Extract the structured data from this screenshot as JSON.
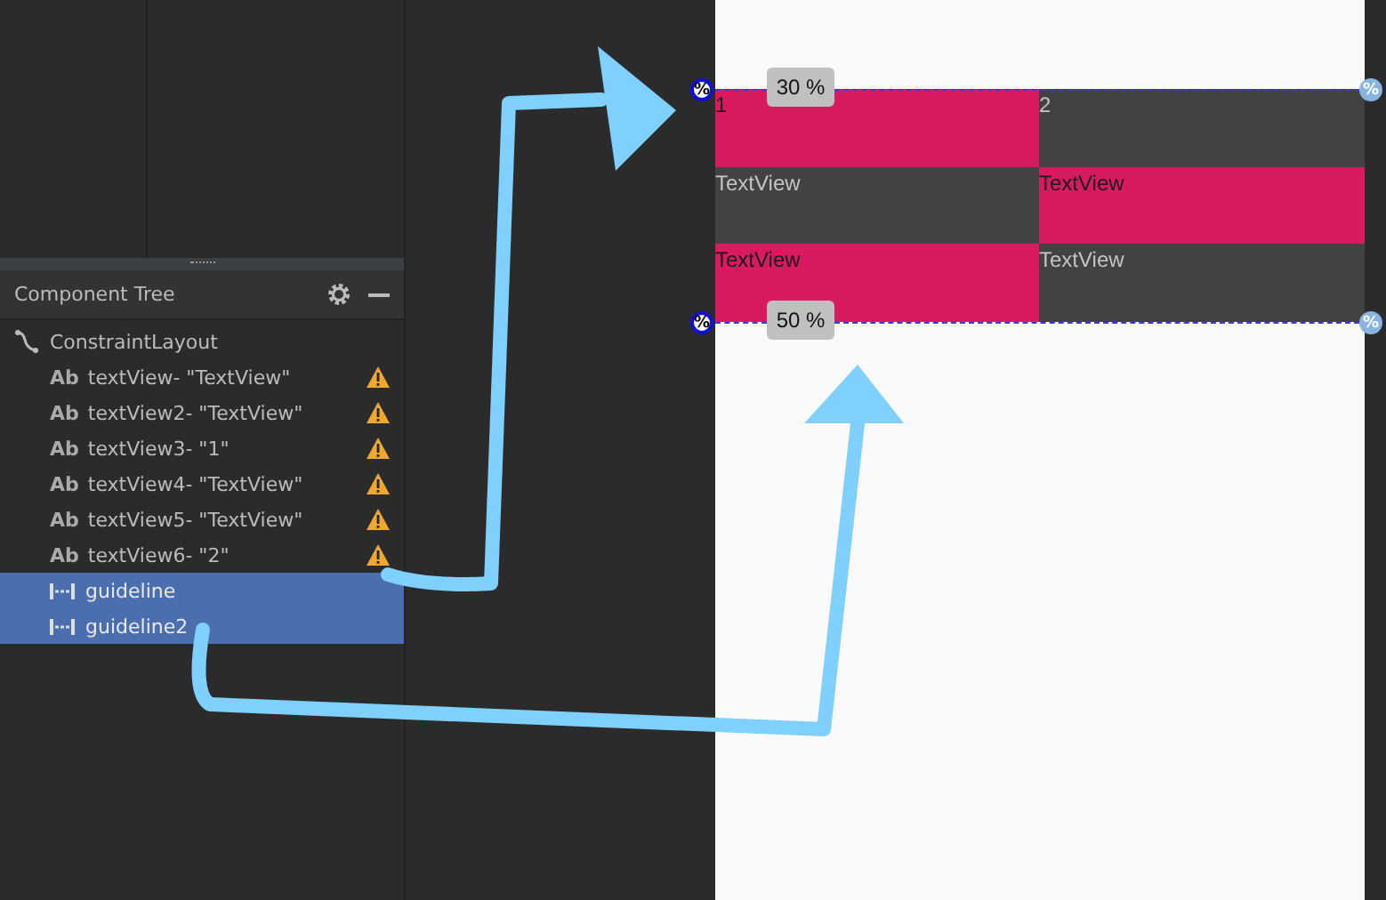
{
  "component_tree": {
    "title": "Component Tree",
    "items": [
      {
        "kind": "layout",
        "label": "ConstraintLayout",
        "warning": false,
        "selected": false
      },
      {
        "kind": "text",
        "icon_text": "Ab",
        "label": "textView- \"TextView\"",
        "warning": true,
        "selected": false
      },
      {
        "kind": "text",
        "icon_text": "Ab",
        "label": "textView2- \"TextView\"",
        "warning": true,
        "selected": false
      },
      {
        "kind": "text",
        "icon_text": "Ab",
        "label": "textView3- \"1\"",
        "warning": true,
        "selected": false
      },
      {
        "kind": "text",
        "icon_text": "Ab",
        "label": "textView4- \"TextView\"",
        "warning": true,
        "selected": false
      },
      {
        "kind": "text",
        "icon_text": "Ab",
        "label": "textView5- \"TextView\"",
        "warning": true,
        "selected": false
      },
      {
        "kind": "text",
        "icon_text": "Ab",
        "label": "textView6- \"2\"",
        "warning": true,
        "selected": false
      },
      {
        "kind": "guideline",
        "label": "guideline",
        "warning": false,
        "selected": true
      },
      {
        "kind": "guideline",
        "label": "guideline2",
        "warning": false,
        "selected": true
      }
    ]
  },
  "design": {
    "cells": [
      {
        "text": "1",
        "color": "#d81b60"
      },
      {
        "text": "2",
        "color": "#424242"
      },
      {
        "text": "TextView",
        "color": "#424242"
      },
      {
        "text": "TextView",
        "color": "#d81b60"
      },
      {
        "text": "TextView",
        "color": "#d81b60"
      },
      {
        "text": "TextView",
        "color": "#424242"
      }
    ],
    "guidelines": [
      {
        "label": "30 %",
        "handles": [
          "%",
          "%"
        ]
      },
      {
        "label": "50 %",
        "handles": [
          "%",
          "%"
        ]
      }
    ]
  }
}
